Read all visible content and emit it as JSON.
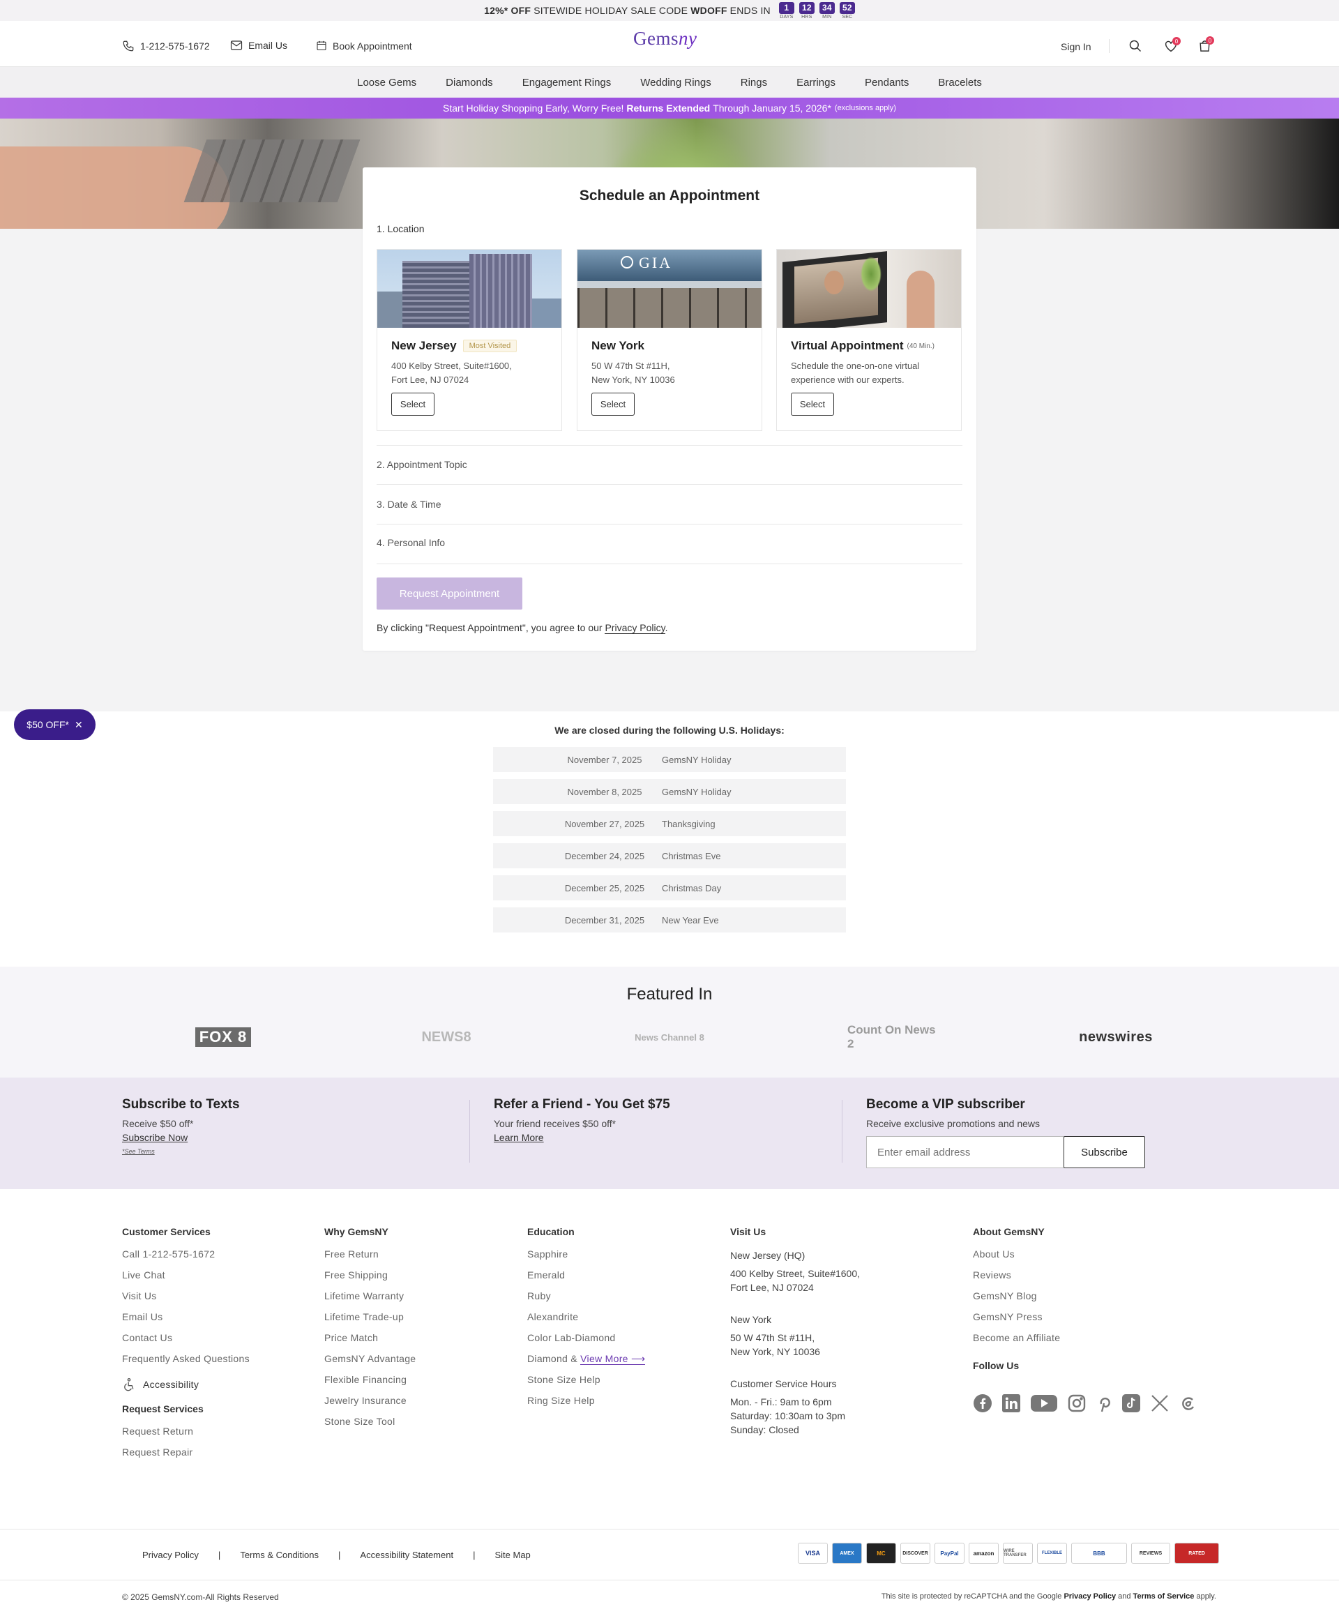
{
  "promo": {
    "pct": "12%*",
    "off": "OFF",
    "mid": "SITEWIDE HOLIDAY SALE CODE",
    "code": "WDOFF",
    "ends": "ENDS IN",
    "countdown": [
      {
        "value": "1",
        "label": "DAYS"
      },
      {
        "value": "12",
        "label": "HRS"
      },
      {
        "value": "34",
        "label": "MIN"
      },
      {
        "value": "52",
        "label": "SEC"
      }
    ]
  },
  "header": {
    "phone": "1-212-575-1672",
    "email": "Email Us",
    "book": "Book Appointment",
    "logo_a": "Gems",
    "logo_b": "ny",
    "signin": "Sign In",
    "wish_count": "0",
    "cart_count": "0"
  },
  "nav": [
    "Loose Gems",
    "Diamonds",
    "Engagement Rings",
    "Wedding Rings",
    "Rings",
    "Earrings",
    "Pendants",
    "Bracelets"
  ],
  "banner": {
    "a": "Start Holiday Shopping Early, Worry Free!",
    "b": "Returns Extended",
    "c": "Through January 15, 2026*",
    "d": "(exclusions apply)"
  },
  "appointment": {
    "title": "Schedule an Appointment",
    "step1": "1. Location",
    "locations": [
      {
        "name": "New Jersey",
        "tag": "Most Visited",
        "addr1": "400 Kelby Street, Suite#1600,",
        "addr2": "Fort Lee, NJ 07024",
        "button": "Select",
        "image_text": ""
      },
      {
        "name": "New York",
        "tag": "",
        "addr1": "50 W 47th St #11H,",
        "addr2": "New York, NY 10036",
        "button": "Select",
        "image_text": "GIA"
      },
      {
        "name": "Virtual Appointment",
        "tag": "(40 Min.)",
        "addr1": "Schedule the one-on-one virtual",
        "addr2": "experience with our experts.",
        "button": "Select",
        "image_text": ""
      }
    ],
    "step2": "2. Appointment Topic",
    "step3": "3. Date & Time",
    "step4": "4. Personal Info",
    "request_button": "Request Appointment",
    "agree_text": "By clicking \"Request Appointment\", you agree to our",
    "agree_link": "Privacy Policy",
    "agree_end": "."
  },
  "offer_pill": {
    "label": "$50 OFF*",
    "close": "✕"
  },
  "holidays": {
    "title": "We are closed during the following U.S. Holidays:",
    "rows": [
      {
        "date": "November 7, 2025",
        "name": "GemsNY Holiday"
      },
      {
        "date": "November 8, 2025",
        "name": "GemsNY Holiday"
      },
      {
        "date": "November 27, 2025",
        "name": "Thanksgiving"
      },
      {
        "date": "December 24, 2025",
        "name": "Christmas Eve"
      },
      {
        "date": "December 25, 2025",
        "name": "Christmas Day"
      },
      {
        "date": "December 31, 2025",
        "name": "New Year Eve"
      }
    ]
  },
  "featured": {
    "title": "Featured In",
    "logos": [
      "FOX 8",
      "NEWS8",
      "News Channel 8",
      "Count On News 2",
      "newswires"
    ]
  },
  "subscribe": {
    "texts": {
      "title": "Subscribe to Texts",
      "sub": "Receive $50 off*",
      "link": "Subscribe Now",
      "terms": "*See Terms"
    },
    "refer": {
      "title": "Refer a Friend - You Get $75",
      "sub": "Your friend receives $50 off*",
      "link": "Learn More"
    },
    "vip": {
      "title": "Become a VIP subscriber",
      "sub": "Receive exclusive promotions and news",
      "placeholder": "Enter email address",
      "button": "Subscribe"
    }
  },
  "footer": {
    "customer": {
      "title": "Customer Services",
      "items": [
        "Call 1-212-575-1672",
        "Live Chat",
        "Visit Us",
        "Email Us",
        "Contact Us",
        "Frequently Asked Questions"
      ],
      "accessibility": "Accessibility"
    },
    "request": {
      "title": "Request Services",
      "items": [
        "Request Return",
        "Request Repair"
      ]
    },
    "why": {
      "title": "Why GemsNY",
      "items": [
        "Free Return",
        "Free Shipping",
        "Lifetime Warranty",
        "Lifetime Trade-up",
        "Price Match",
        "GemsNY Advantage",
        "Flexible Financing",
        "Jewelry Insurance",
        "Stone Size Tool"
      ]
    },
    "education": {
      "title": "Education",
      "items": [
        "Sapphire",
        "Emerald",
        "Ruby",
        "Alexandrite",
        "Color Lab-Diamond"
      ],
      "diamond": "Diamond &",
      "viewmore": "View More",
      "items2": [
        "Stone Size Help",
        "Ring Size Help"
      ]
    },
    "visit": {
      "title": "Visit Us",
      "nj_label": "New Jersey (HQ)",
      "nj1": "400 Kelby Street, Suite#1600,",
      "nj2": "Fort Lee, NJ 07024",
      "ny_label": "New York",
      "ny1": "50 W 47th St #11H,",
      "ny2": "New York, NY 10036",
      "hours_label": "Customer Service Hours",
      "h1": "Mon. - Fri.: 9am to 6pm",
      "h2": "Saturday: 10:30am to 3pm",
      "h3": "Sunday: Closed"
    },
    "about": {
      "title": "About GemsNY",
      "items": [
        "About Us",
        "Reviews",
        "GemsNY Blog",
        "GemsNY Press",
        "Become an Affiliate"
      ]
    },
    "follow": {
      "title": "Follow Us",
      "icons": [
        "facebook-icon",
        "linkedin-icon",
        "youtube-icon",
        "instagram-icon",
        "pinterest-icon",
        "tiktok-icon",
        "x-icon",
        "threads-icon"
      ]
    }
  },
  "legal": {
    "links": [
      "Privacy Policy",
      "Terms & Conditions",
      "Accessibility Statement",
      "Site Map"
    ],
    "sep": "|",
    "payments": [
      "VISA",
      "AMEX",
      "MC",
      "DISCOVER",
      "PayPal",
      "amazon",
      "WIRE TRANSFER",
      "FLEXIBLE",
      "BBB",
      "REVIEWS",
      "RATED"
    ],
    "copyright": "© 2025 GemsNY.com-All Rights Reserved",
    "recaptcha_a": "This site is protected by reCAPTCHA and the Google",
    "recaptcha_pp": "Privacy Policy",
    "recaptcha_and": "and",
    "recaptcha_tos": "Terms of Service",
    "recaptcha_end": "apply."
  },
  "colors": {
    "brand": "#4b2a8f",
    "accent": "#9b4fe0",
    "button_disabled": "#c8b6df",
    "pill": "#3a1d8a"
  }
}
